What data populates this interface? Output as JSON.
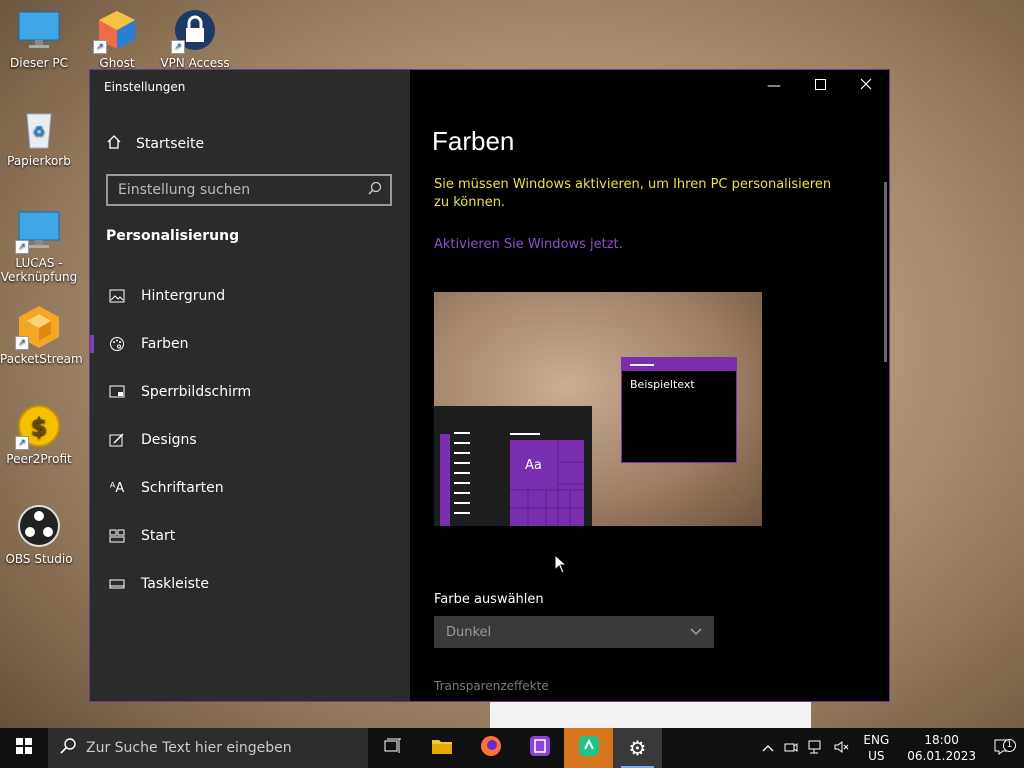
{
  "desktop": {
    "icons": [
      {
        "label": "Dieser PC"
      },
      {
        "label": "Ghost"
      },
      {
        "label": "VPN Access"
      },
      {
        "label": "Papierkorb"
      },
      {
        "label": "LUCAS - Verknüpfung"
      },
      {
        "label": "PacketStream"
      },
      {
        "label": "Peer2Profit"
      },
      {
        "label": "OBS Studio"
      }
    ]
  },
  "window": {
    "title": "Einstellungen",
    "accent": "#7a2fb0"
  },
  "sidebar": {
    "home": "Startseite",
    "search_placeholder": "Einstellung suchen",
    "section": "Personalisierung",
    "items": [
      {
        "label": "Hintergrund",
        "icon": "picture-icon"
      },
      {
        "label": "Farben",
        "icon": "palette-icon",
        "active": true
      },
      {
        "label": "Sperrbildschirm",
        "icon": "lock-screen-icon"
      },
      {
        "label": "Designs",
        "icon": "brush-icon"
      },
      {
        "label": "Schriftarten",
        "icon": "fonts-icon"
      },
      {
        "label": "Start",
        "icon": "start-icon"
      },
      {
        "label": "Taskleiste",
        "icon": "taskbar-icon"
      }
    ]
  },
  "content": {
    "title": "Farben",
    "warning": "Sie müssen Windows aktivieren, um Ihren PC personalisieren zu können.",
    "activate_link": "Aktivieren Sie Windows jetzt.",
    "preview": {
      "tile_text": "Aa",
      "sample_text": "Beispieltext"
    },
    "choose_color_label": "Farbe auswählen",
    "choose_color_value": "Dunkel",
    "transparency_label": "Transparenzeffekte"
  },
  "taskbar": {
    "search_placeholder": "Zur Suche Text hier eingeben",
    "lang_top": "ENG",
    "lang_bottom": "US",
    "time": "18:00",
    "date": "06.01.2023",
    "notification_count": "1"
  }
}
